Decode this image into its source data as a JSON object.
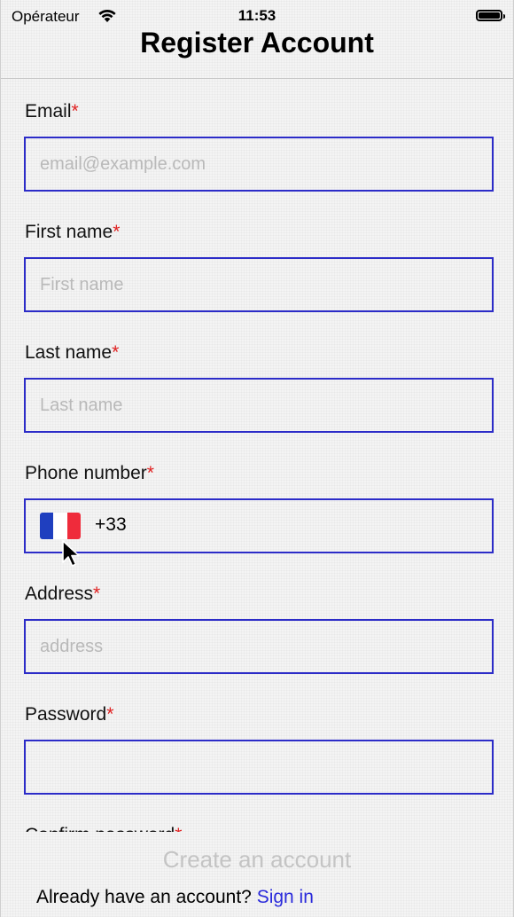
{
  "status_bar": {
    "carrier": "Opérateur",
    "time": "11:53"
  },
  "header": {
    "title": "Register Account"
  },
  "form": {
    "required_mark": "*",
    "email": {
      "label": "Email",
      "placeholder": "email@example.com",
      "value": ""
    },
    "first_name": {
      "label": "First name",
      "placeholder": "First name",
      "value": ""
    },
    "last_name": {
      "label": "Last name",
      "placeholder": "Last name",
      "value": ""
    },
    "phone": {
      "label": "Phone number",
      "country": "FR",
      "dial_code": "+33"
    },
    "address": {
      "label": "Address",
      "placeholder": "address",
      "value": ""
    },
    "password": {
      "label": "Password",
      "placeholder": "",
      "value": ""
    },
    "confirm_password": {
      "label": "Confirm password"
    }
  },
  "footer": {
    "create_label": "Create an account",
    "signin_prompt": "Already have an account?",
    "signin_link": "Sign in"
  },
  "colors": {
    "input_border": "#2c2cc8",
    "required": "#e02020",
    "link": "#2a2adb",
    "disabled_button": "#c4c4c4"
  }
}
